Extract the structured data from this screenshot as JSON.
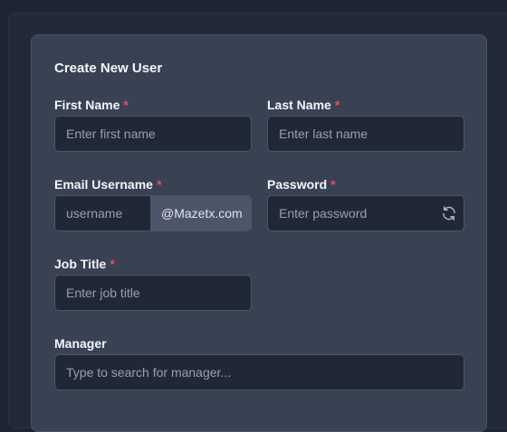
{
  "form": {
    "title": "Create New User",
    "required_marker": "*",
    "first_name": {
      "label": "First Name",
      "placeholder": "Enter first name",
      "value": ""
    },
    "last_name": {
      "label": "Last Name",
      "placeholder": "Enter last name",
      "value": ""
    },
    "email_username": {
      "label": "Email Username",
      "placeholder": "username",
      "value": "",
      "domain_suffix": "@Mazetx.com"
    },
    "password": {
      "label": "Password",
      "placeholder": "Enter password",
      "value": "",
      "icon": "refresh-icon"
    },
    "job_title": {
      "label": "Job Title",
      "placeholder": "Enter job title",
      "value": ""
    },
    "manager": {
      "label": "Manager",
      "placeholder": "Type to search for manager...",
      "value": ""
    }
  },
  "colors": {
    "background": "#1e2532",
    "outer_panel": "#222a37",
    "card": "#394253",
    "input_bg": "#202835",
    "addon_bg": "#4d5668",
    "required": "#ef4b57",
    "label": "#f4f6fa",
    "placeholder": "#97a0b0"
  }
}
